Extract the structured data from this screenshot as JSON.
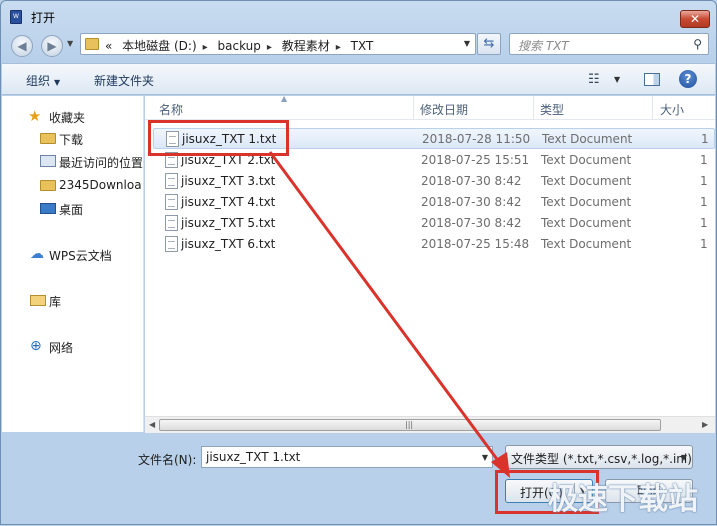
{
  "window": {
    "title": "打开",
    "close_label": "✕"
  },
  "nav": {
    "back_icon": "back-arrow-icon",
    "forward_icon": "forward-arrow-icon"
  },
  "address": {
    "overflow": "«",
    "crumbs": [
      "本地磁盘 (D:)",
      "backup",
      "教程素材",
      "TXT"
    ]
  },
  "search": {
    "placeholder": "搜索 TXT"
  },
  "toolbar": {
    "organize": "组织",
    "new_folder": "新建文件夹"
  },
  "sidebar": {
    "items": [
      {
        "label": "收藏夹",
        "icon": "star-icon"
      },
      {
        "label": "下载",
        "icon": "folder-icon"
      },
      {
        "label": "最近访问的位置",
        "icon": "recent-places-icon"
      },
      {
        "label": "2345Downloa",
        "icon": "folder-icon"
      },
      {
        "label": "桌面",
        "icon": "desktop-icon"
      },
      {
        "label": "WPS云文档",
        "icon": "cloud-icon"
      },
      {
        "label": "库",
        "icon": "library-icon"
      },
      {
        "label": "网络",
        "icon": "network-icon"
      }
    ]
  },
  "columns": {
    "name": "名称",
    "date": "修改日期",
    "type": "类型",
    "size": "大小"
  },
  "files": [
    {
      "name": "jisuxz_TXT 1.txt",
      "date": "2018-07-28 11:50",
      "type": "Text Document",
      "size": "1"
    },
    {
      "name": "jisuxz_TXT 2.txt",
      "date": "2018-07-25 15:51",
      "type": "Text Document",
      "size": "1"
    },
    {
      "name": "jisuxz_TXT 3.txt",
      "date": "2018-07-30 8:42",
      "type": "Text Document",
      "size": "1"
    },
    {
      "name": "jisuxz_TXT 4.txt",
      "date": "2018-07-30 8:42",
      "type": "Text Document",
      "size": "1"
    },
    {
      "name": "jisuxz_TXT 5.txt",
      "date": "2018-07-30 8:42",
      "type": "Text Document",
      "size": "1"
    },
    {
      "name": "jisuxz_TXT 6.txt",
      "date": "2018-07-25 15:48",
      "type": "Text Document",
      "size": "1"
    }
  ],
  "selected_file_index": 0,
  "bottom": {
    "filename_label": "文件名(N):",
    "filename_value": "jisuxz_TXT 1.txt",
    "filetype_value": "文件类型 (*.txt,*.csv,*.log,*.ini)",
    "open_label": "打开(O)",
    "cancel_label": "取消"
  },
  "watermark": "极速下载站",
  "colors": {
    "highlight": "#d9332b",
    "selection": "#dbe8f8"
  }
}
